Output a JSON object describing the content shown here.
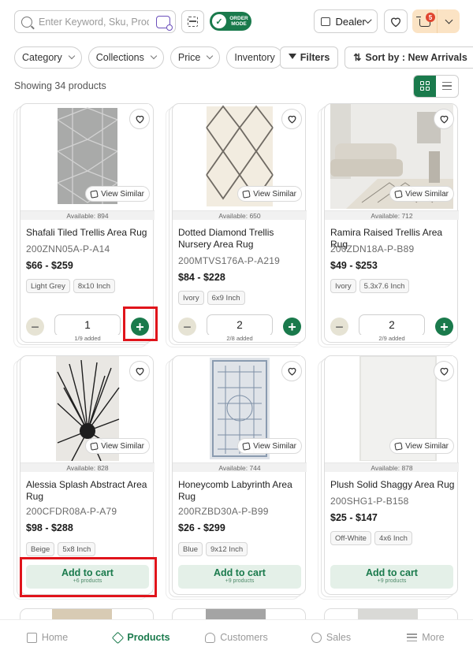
{
  "header": {
    "search_placeholder": "Enter Keyword, Sku, Produ...",
    "order_mode_label": "ORDER MODE",
    "dealer_label": "Dealer",
    "cart_count": "5"
  },
  "filters": {
    "chips": [
      "Category",
      "Collections",
      "Price",
      "Inventory"
    ],
    "filters_label": "Filters",
    "sort_label": "Sort by : New Arrivals"
  },
  "results_text": "Showing 34 products",
  "view_similar_label": "View Similar",
  "add_to_cart": {
    "label": "Add to cart"
  },
  "products": [
    {
      "available": "Available: 894",
      "name": "Shafali Tiled Trellis Area Rug",
      "sku": "200ZNN05A-P-A14",
      "price": "$66 - $259",
      "tags": [
        "Light Grey",
        "8x10 Inch"
      ],
      "quantity": "1",
      "added": "1/9 added"
    },
    {
      "available": "Available: 650",
      "name": "Dotted Diamond Trellis Nursery Area Rug",
      "sku": "200MTVS176A-P-A219",
      "price": "$84 - $228",
      "tags": [
        "Ivory",
        "6x9 Inch"
      ],
      "quantity": "2",
      "added": "2/8 added"
    },
    {
      "available": "Available: 712",
      "name": "Ramira Raised Trellis Area Rug",
      "sku": "200ZDN18A-P-B89",
      "price": "$49 - $253",
      "tags": [
        "Ivory",
        "5.3x7.6 Inch"
      ],
      "quantity": "2",
      "added": "2/9 added"
    },
    {
      "available": "Available: 828",
      "name": "Alessia Splash Abstract Area Rug",
      "sku": "200CFDR08A-P-A79",
      "price": "$98 - $288",
      "tags": [
        "Beige",
        "5x8 Inch"
      ],
      "more_products": "+6 products"
    },
    {
      "available": "Available: 744",
      "name": "Honeycomb Labyrinth Area Rug",
      "sku": "200RZBD30A-P-B99",
      "price": "$26 - $299",
      "tags": [
        "Blue",
        "9x12 Inch"
      ],
      "more_products": "+9 products"
    },
    {
      "available": "Available: 878",
      "name": "Plush Solid Shaggy Area Rug",
      "sku": "200SHG1-P-B158",
      "price": "$25 - $147",
      "tags": [
        "Off-White",
        "4x6 Inch"
      ],
      "more_products": "+9 products"
    }
  ],
  "bottom_nav": [
    {
      "label": "Home",
      "icon": "home-icon"
    },
    {
      "label": "Products",
      "icon": "products-icon"
    },
    {
      "label": "Customers",
      "icon": "customers-icon"
    },
    {
      "label": "Sales",
      "icon": "sales-icon"
    },
    {
      "label": "More",
      "icon": "menu-icon"
    }
  ],
  "colors": {
    "accent": "#1a7a4c",
    "cart_bg": "#fbe3c4",
    "badge": "#e0452f",
    "highlight": "#e0141b"
  }
}
